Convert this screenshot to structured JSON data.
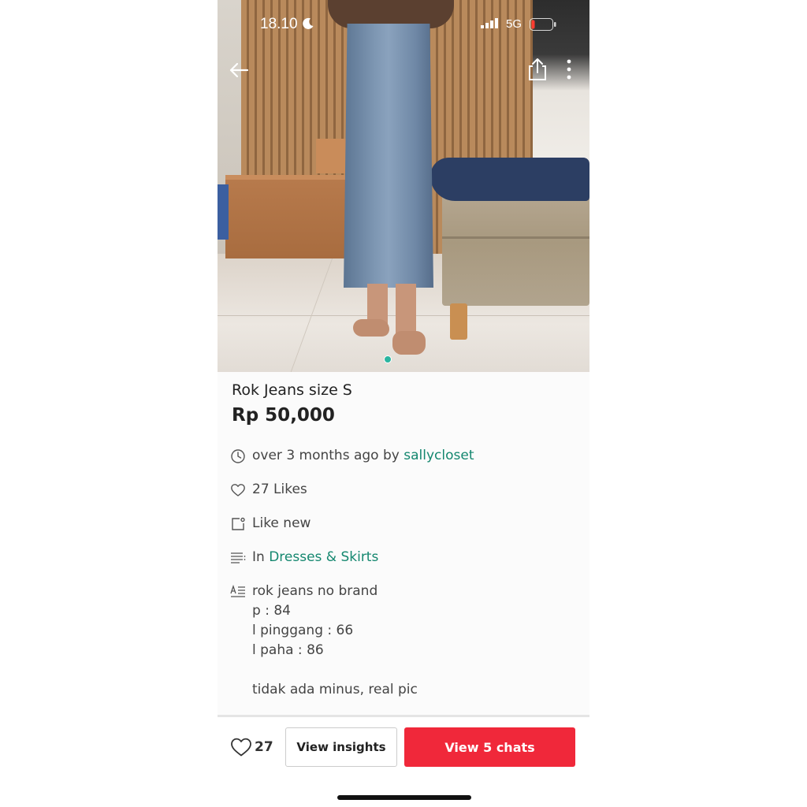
{
  "status_bar": {
    "time": "18.10",
    "network": "5G",
    "moon_icon": "moon-icon",
    "signal_icon": "signal-icon",
    "battery_icon": "battery-low-icon",
    "battery_color": "#ff3b30"
  },
  "header": {
    "back_icon": "arrow-left-icon",
    "share_icon": "share-icon",
    "more_icon": "more-vertical-icon"
  },
  "gallery": {
    "current_index": 1,
    "total": 1
  },
  "listing": {
    "title": "Rok Jeans size S",
    "price": "Rp 50,000",
    "posted_prefix": "over 3 months ago by",
    "seller": "sallycloset",
    "likes": "27 Likes",
    "condition": "Like new",
    "category_prefix": "In",
    "category": "Dresses & Skirts",
    "description": "rok jeans no brand\np : 84\nl pinggang : 66\nl paha : 86\n\ntidak ada minus, real pic"
  },
  "icons": {
    "time": "clock-icon",
    "likes": "heart-icon",
    "condition": "tag-icon",
    "category": "list-icon",
    "description": "text-icon"
  },
  "bottom_bar": {
    "like_count": "27",
    "insights_label": "View insights",
    "chats_label": "View 5 chats"
  },
  "colors": {
    "accent_link": "#14876f",
    "chat_button": "#f0283a",
    "page_dot": "#2bb5a0"
  }
}
